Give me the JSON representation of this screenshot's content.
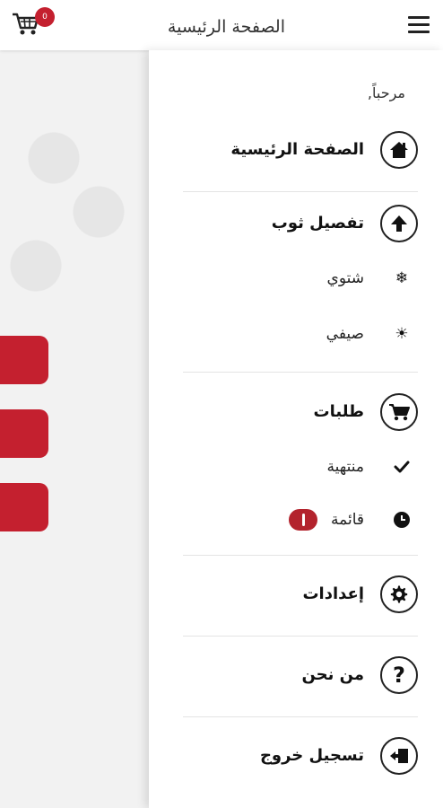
{
  "topbar": {
    "title": "الصفحة الرئيسية",
    "menu_icon": "hamburger-menu-icon",
    "cart_icon": "shopping-cart-icon",
    "cart_count": "0"
  },
  "drawer": {
    "greeting": "مرحباً,",
    "items": [
      {
        "label": "الصفحة الرئيسية",
        "icon": "home-icon"
      },
      {
        "label": "تفصيل ثوب",
        "icon": "arrow-up-icon"
      },
      {
        "label": "طلبات",
        "icon": "cart-icon"
      },
      {
        "label": "إعدادات",
        "icon": "gear-icon"
      },
      {
        "label": "من نحن",
        "icon": "question-icon"
      },
      {
        "label": "تسجيل خروج",
        "icon": "logout-icon"
      }
    ],
    "subitems": [
      {
        "label": "شتوي",
        "icon": "snowflake-icon"
      },
      {
        "label": "صيفي",
        "icon": "sun-icon"
      },
      {
        "label": "منتهية",
        "icon": "checkmark-icon"
      },
      {
        "label": "قائمة",
        "icon": "clock-icon"
      }
    ]
  },
  "colors": {
    "accent": "#c4202f",
    "badge": "#b3232d"
  }
}
